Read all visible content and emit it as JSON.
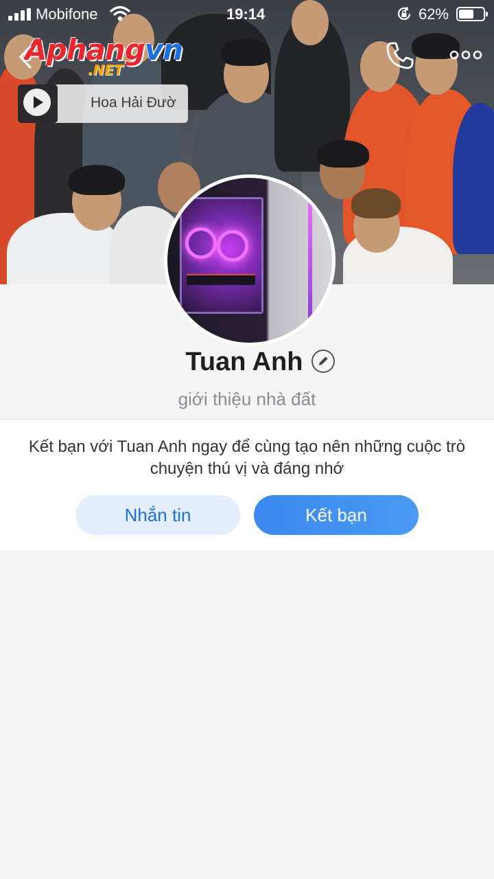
{
  "status_bar": {
    "carrier": "Mobifone",
    "time": "19:14",
    "battery_percent": "62%",
    "battery_level": 0.62
  },
  "watermark": {
    "logo_text": "Aphangvn",
    "logo_suffix": ".NET"
  },
  "nav": {
    "back_icon": "chevron-left-icon",
    "call_icon": "phone-icon",
    "more_icon": "more-horizontal-icon"
  },
  "music": {
    "title": "Hoa Hải Đườ",
    "thumb_icon": "play-icon"
  },
  "profile": {
    "name": "Tuan Anh",
    "bio": "giới thiệu nhà đất",
    "edit_icon": "pencil-icon"
  },
  "friend_card": {
    "prompt": "Kết bạn với Tuan Anh ngay để cùng tạo nên những cuộc trò chuyện thú vị và đáng nhớ",
    "message_button": "Nhắn tin",
    "add_friend_button": "Kết bạn"
  },
  "colors": {
    "primary": "#3b8ff0",
    "secondary_button_bg": "#e4eefc",
    "page_bg": "#f4f4f5"
  }
}
